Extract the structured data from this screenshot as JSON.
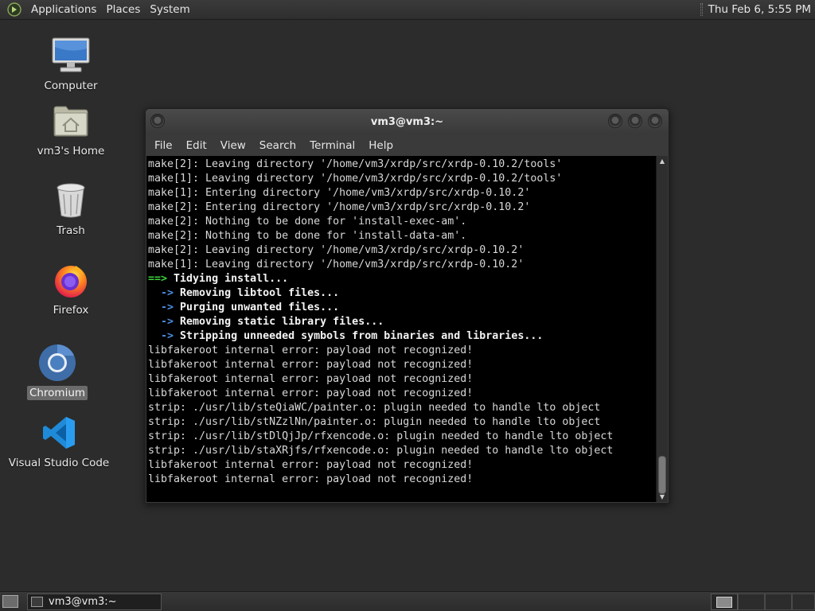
{
  "top_panel": {
    "menus": [
      "Applications",
      "Places",
      "System"
    ],
    "clock": "Thu Feb  6,  5:55 PM"
  },
  "desktop": {
    "icons": [
      {
        "label": "Computer",
        "icon": "computer-icon"
      },
      {
        "label": "vm3's Home",
        "icon": "home-folder-icon"
      },
      {
        "label": "Trash",
        "icon": "trash-icon"
      },
      {
        "label": "Firefox",
        "icon": "firefox-icon"
      },
      {
        "label": "Chromium",
        "icon": "chromium-icon",
        "selected": true
      },
      {
        "label": "Visual Studio Code",
        "icon": "vscode-icon"
      }
    ]
  },
  "window": {
    "title": "vm3@vm3:~",
    "menus": [
      "File",
      "Edit",
      "View",
      "Search",
      "Terminal",
      "Help"
    ]
  },
  "terminal": {
    "lines": [
      [
        {
          "t": "make[2]: Leaving directory '/home/vm3/xrdp/src/xrdp-0.10.2/tools'"
        }
      ],
      [
        {
          "t": "make[1]: Leaving directory '/home/vm3/xrdp/src/xrdp-0.10.2/tools'"
        }
      ],
      [
        {
          "t": "make[1]: Entering directory '/home/vm3/xrdp/src/xrdp-0.10.2'"
        }
      ],
      [
        {
          "t": "make[2]: Entering directory '/home/vm3/xrdp/src/xrdp-0.10.2'"
        }
      ],
      [
        {
          "t": "make[2]: Nothing to be done for 'install-exec-am'."
        }
      ],
      [
        {
          "t": "make[2]: Nothing to be done for 'install-data-am'."
        }
      ],
      [
        {
          "t": "make[2]: Leaving directory '/home/vm3/xrdp/src/xrdp-0.10.2'"
        }
      ],
      [
        {
          "t": "make[1]: Leaving directory '/home/vm3/xrdp/src/xrdp-0.10.2'"
        }
      ],
      [
        {
          "t": "==>",
          "s": "g"
        },
        {
          "t": " Tidying install...",
          "s": "b"
        }
      ],
      [
        {
          "t": "  ->",
          "s": "c"
        },
        {
          "t": " Removing libtool files...",
          "s": "b"
        }
      ],
      [
        {
          "t": "  ->",
          "s": "c"
        },
        {
          "t": " Purging unwanted files...",
          "s": "b"
        }
      ],
      [
        {
          "t": "  ->",
          "s": "c"
        },
        {
          "t": " Removing static library files...",
          "s": "b"
        }
      ],
      [
        {
          "t": "  ->",
          "s": "c"
        },
        {
          "t": " Stripping unneeded symbols from binaries and libraries...",
          "s": "b"
        }
      ],
      [
        {
          "t": "libfakeroot internal error: payload not recognized!"
        }
      ],
      [
        {
          "t": "libfakeroot internal error: payload not recognized!"
        }
      ],
      [
        {
          "t": "libfakeroot internal error: payload not recognized!"
        }
      ],
      [
        {
          "t": "libfakeroot internal error: payload not recognized!"
        }
      ],
      [
        {
          "t": "strip: ./usr/lib/steQiaWC/painter.o: plugin needed to handle lto object"
        }
      ],
      [
        {
          "t": "strip: ./usr/lib/stNZzlNn/painter.o: plugin needed to handle lto object"
        }
      ],
      [
        {
          "t": "strip: ./usr/lib/stDlQjJp/rfxencode.o: plugin needed to handle lto object"
        }
      ],
      [
        {
          "t": "strip: ./usr/lib/staXRjfs/rfxencode.o: plugin needed to handle lto object"
        }
      ],
      [
        {
          "t": "libfakeroot internal error: payload not recognized!"
        }
      ],
      [
        {
          "t": "libfakeroot internal error: payload not recognized!"
        }
      ]
    ],
    "scroll_position": 1.0
  },
  "bottom_panel": {
    "task_label": "vm3@vm3:~"
  }
}
